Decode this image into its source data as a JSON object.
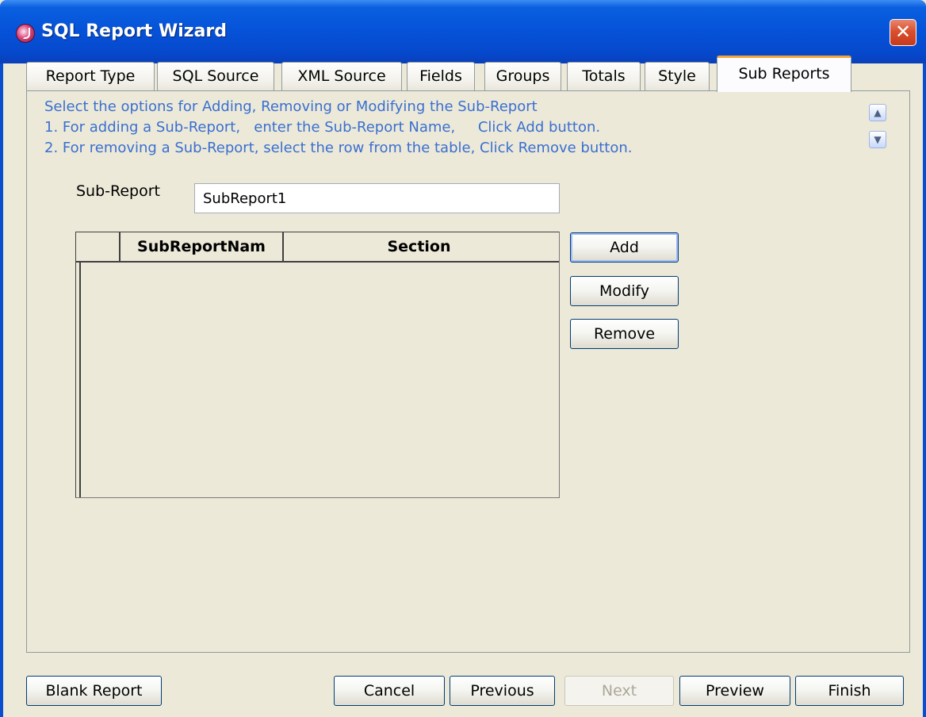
{
  "window": {
    "title": "SQL Report Wizard",
    "close_label": "✕",
    "accent": "#0552d8"
  },
  "tabs": [
    {
      "label": "Report Type"
    },
    {
      "label": "SQL Source"
    },
    {
      "label": "XML Source"
    },
    {
      "label": "Fields"
    },
    {
      "label": "Groups"
    },
    {
      "label": "Totals"
    },
    {
      "label": "Style"
    },
    {
      "label": "Sub Reports",
      "active": true
    }
  ],
  "instructions": {
    "line1": "Select the options for Adding, Removing or Modifying the Sub-Report",
    "line2": "1. For adding a Sub-Report,   enter the Sub-Report Name,     Click Add button.",
    "line3": "2. For removing a Sub-Report, select the row from the table, Click Remove button.",
    "color": "#3a6fd0"
  },
  "subreport": {
    "label": "Sub-Report",
    "value": "SubReport1"
  },
  "table": {
    "columns": [
      "",
      "SubReportNam",
      "Section"
    ],
    "rows": []
  },
  "actions": {
    "add": "Add",
    "modify": "Modify",
    "remove": "Remove"
  },
  "footer": {
    "blank_report": "Blank Report",
    "cancel": "Cancel",
    "previous": "Previous",
    "next": "Next",
    "preview": "Preview",
    "finish": "Finish"
  }
}
